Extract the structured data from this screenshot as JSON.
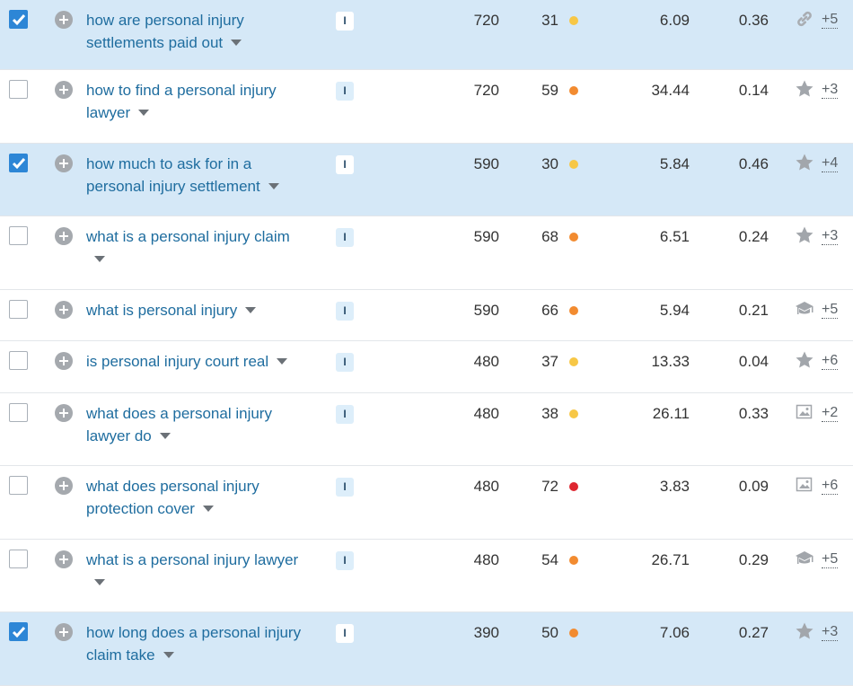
{
  "colors": {
    "selected_row": "#d5e8f7",
    "link": "#1f6d9f",
    "checkbox": "#2d86d6",
    "kd_easy": "#f7c746",
    "kd_medium": "#f28b30",
    "kd_hard": "#de2630"
  },
  "rows": [
    {
      "selected": true,
      "keyword": "how are personal injury settlements paid out",
      "intent": "I",
      "volume": "720",
      "kd": "31",
      "kd_level": "easy",
      "cpc": "6.09",
      "com": "0.36",
      "feature_icon": "link-icon",
      "more": "+5"
    },
    {
      "selected": false,
      "keyword": "how to find a personal injury lawyer",
      "intent": "I",
      "volume": "720",
      "kd": "59",
      "kd_level": "medium",
      "cpc": "34.44",
      "com": "0.14",
      "feature_icon": "star-icon",
      "more": "+3"
    },
    {
      "selected": true,
      "keyword": "how much to ask for in a personal injury settlement",
      "intent": "I",
      "volume": "590",
      "kd": "30",
      "kd_level": "easy",
      "cpc": "5.84",
      "com": "0.46",
      "feature_icon": "star-icon",
      "more": "+4"
    },
    {
      "selected": false,
      "keyword": "what is a personal injury claim",
      "intent": "I",
      "volume": "590",
      "kd": "68",
      "kd_level": "medium",
      "cpc": "6.51",
      "com": "0.24",
      "feature_icon": "star-icon",
      "more": "+3"
    },
    {
      "selected": false,
      "keyword": "what is personal injury",
      "intent": "I",
      "volume": "590",
      "kd": "66",
      "kd_level": "medium",
      "cpc": "5.94",
      "com": "0.21",
      "feature_icon": "graduation-cap-icon",
      "more": "+5"
    },
    {
      "selected": false,
      "keyword": "is personal injury court real",
      "intent": "I",
      "volume": "480",
      "kd": "37",
      "kd_level": "easy",
      "cpc": "13.33",
      "com": "0.04",
      "feature_icon": "star-icon",
      "more": "+6"
    },
    {
      "selected": false,
      "keyword": "what does a personal injury lawyer do",
      "intent": "I",
      "volume": "480",
      "kd": "38",
      "kd_level": "easy",
      "cpc": "26.11",
      "com": "0.33",
      "feature_icon": "image-icon",
      "more": "+2"
    },
    {
      "selected": false,
      "keyword": "what does personal injury protection cover",
      "intent": "I",
      "volume": "480",
      "kd": "72",
      "kd_level": "hard",
      "cpc": "3.83",
      "com": "0.09",
      "feature_icon": "image-icon",
      "more": "+6"
    },
    {
      "selected": false,
      "keyword": "what is a personal injury lawyer",
      "intent": "I",
      "volume": "480",
      "kd": "54",
      "kd_level": "medium",
      "cpc": "26.71",
      "com": "0.29",
      "feature_icon": "graduation-cap-icon",
      "more": "+5"
    },
    {
      "selected": true,
      "keyword": "how long does a personal injury claim take",
      "intent": "I",
      "volume": "390",
      "kd": "50",
      "kd_level": "medium",
      "cpc": "7.06",
      "com": "0.27",
      "feature_icon": "star-icon",
      "more": "+3"
    }
  ]
}
